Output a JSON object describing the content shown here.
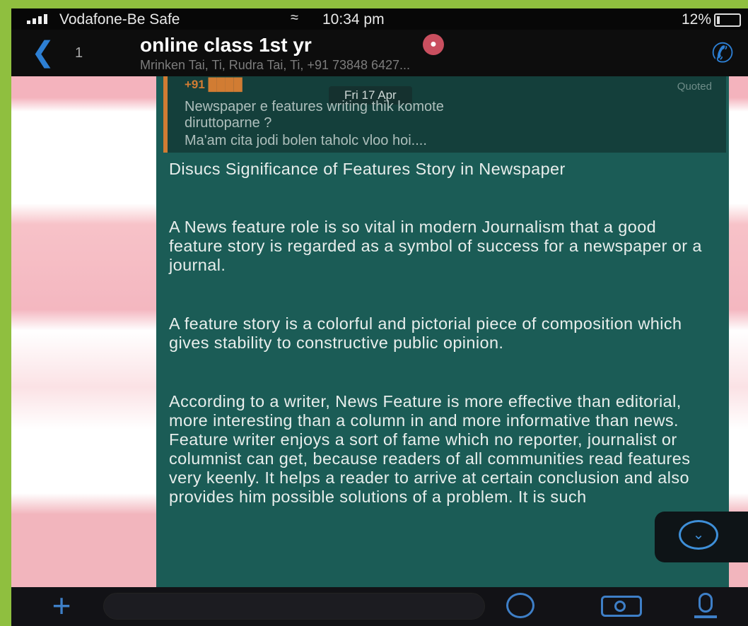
{
  "status_bar": {
    "carrier": "Vodafone-Be Safe",
    "wifi_icon": "wifi-icon",
    "time": "10:34 pm",
    "battery": "12%"
  },
  "header": {
    "back_icon": "chevron-left-icon",
    "back_count": "1",
    "title": "online class 1st yr",
    "subtitle": "Mrinken Tai, Ti, Rudra Tai, Ti, +91 73848 6427...",
    "call_icon": "add-call-icon"
  },
  "quoted_message": {
    "date_badge": "Fri 17 Apr",
    "line1": "Newspaper e features writing thik komote",
    "line2": "diruttoparne ?",
    "line3": "Ma'am cita jodi bolen taholc vloo hoi....",
    "accent_color": "#d17c33"
  },
  "message": {
    "paragraph1": "Disucs Significance of Features Story in Newspaper",
    "paragraph2": "A News feature role is so vital in modern Journalism that a good feature story is regarded as a symbol of success for a newspaper or a journal.",
    "paragraph3": "A feature story is a colorful and pictorial piece of composition which gives stability to constructive public opinion.",
    "paragraph4": "According to a writer, News Feature is more effective than editorial, more interesting than a column in and more informative than news. Feature writer enjoys a sort of fame which no reporter, journalist or columnist can get, because readers of all communities read features very keenly. It helps a reader to arrive at certain conclusion and also provides him possible solutions of a problem. It is such",
    "bubble_color": "#1b5c56"
  },
  "input_bar": {
    "attach_icon": "plus-icon",
    "placeholder": "",
    "sticker_icon": "sticker-icon",
    "camera_icon": "camera-icon",
    "mic_icon": "microphone-icon"
  }
}
